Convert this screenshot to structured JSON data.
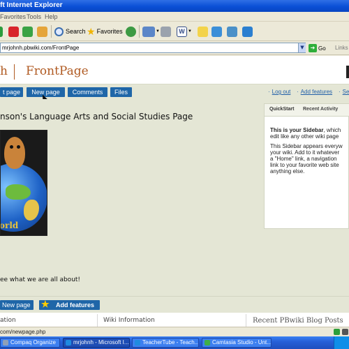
{
  "window": {
    "title": "oft Internet Explorer"
  },
  "menu": {
    "items": [
      "Favorites",
      "Tools",
      "Help"
    ]
  },
  "toolbar": {
    "search_label": "Search",
    "favorites_label": "Favorites"
  },
  "address": {
    "url": "mrjohnh.pbwiki.com/FrontPage",
    "go_label": "Go",
    "links_label": "Links"
  },
  "header": {
    "wiki_name": "h",
    "page_name": "FrontPage"
  },
  "nav": {
    "buttons": [
      "t page",
      "New page",
      "Comments",
      "Files"
    ],
    "links": [
      "Log out",
      "Add features",
      "Se"
    ]
  },
  "content": {
    "title": "nson's Language Arts and Social Studies Page",
    "globe_text": "orld",
    "caption": "ee what we are all about!"
  },
  "sidebar": {
    "tabs": [
      "QuickStart",
      "Recent Activity"
    ],
    "lines": [
      {
        "bold": "This is your Sidebar",
        "rest": ", which"
      },
      {
        "bold": "",
        "rest": "edit like any other wiki page"
      },
      {
        "bold": "",
        "rest": "This Sidebar appears everyw"
      },
      {
        "bold": "",
        "rest": "your wiki. Add to it whatever"
      },
      {
        "bold": "",
        "rest": "a \"Home\" link, a navigation"
      },
      {
        "bold": "",
        "rest": "link to your favorite web site"
      },
      {
        "bold": "",
        "rest": "anything else."
      }
    ]
  },
  "bottom": {
    "new_page": "New page",
    "add_features": "Add features"
  },
  "lower": {
    "col1": "ation",
    "col2": "Wiki Information",
    "col3": "Recent PBwiki Blog Posts"
  },
  "status": {
    "text": "com/newpage.php"
  },
  "taskbar": {
    "items": [
      {
        "label": "Compaq Organize",
        "color": "#8fa0b8"
      },
      {
        "label": "mrjohnh - Microsoft I...",
        "color": "#1f8be0"
      },
      {
        "label": "TeacherTube - Teach...",
        "color": "#1f8be0"
      },
      {
        "label": "Camtasia Studio - Unt...",
        "color": "#3fae48"
      }
    ]
  },
  "colors": {
    "nav_button": "#1f66a8",
    "page_bg": "#e4e6d5",
    "header_text": "#b05a22"
  }
}
